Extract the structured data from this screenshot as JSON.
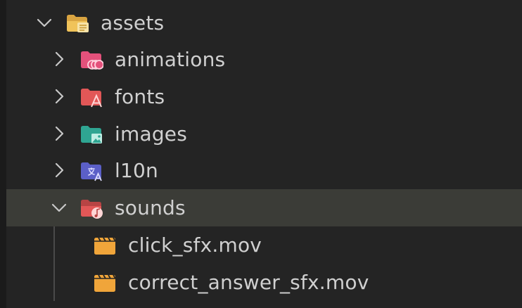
{
  "tree": {
    "root": {
      "label": "assets",
      "expanded": true,
      "icon": "folder-open-assets-icon"
    },
    "items": [
      {
        "label": "animations",
        "expanded": false,
        "icon": "folder-animations-icon",
        "color": "#e4517b"
      },
      {
        "label": "fonts",
        "expanded": false,
        "icon": "folder-fonts-icon",
        "color": "#e25757"
      },
      {
        "label": "images",
        "expanded": false,
        "icon": "folder-images-icon",
        "color": "#2fa592"
      },
      {
        "label": "l10n",
        "expanded": false,
        "icon": "folder-l10n-icon",
        "color": "#5b5fc7"
      },
      {
        "label": "sounds",
        "expanded": true,
        "selected": true,
        "icon": "folder-open-sounds-icon",
        "color": "#e25757"
      }
    ],
    "files": [
      {
        "label": "click_sfx.mov",
        "icon": "video-file-icon",
        "color": "#f0a53a"
      },
      {
        "label": "correct_answer_sfx.mov",
        "icon": "video-file-icon",
        "color": "#f0a53a"
      }
    ]
  },
  "colors": {
    "background": "#242424",
    "selected_row": "#3b3c37",
    "text": "#d0d0d0",
    "chevron": "#c8c8c8"
  }
}
